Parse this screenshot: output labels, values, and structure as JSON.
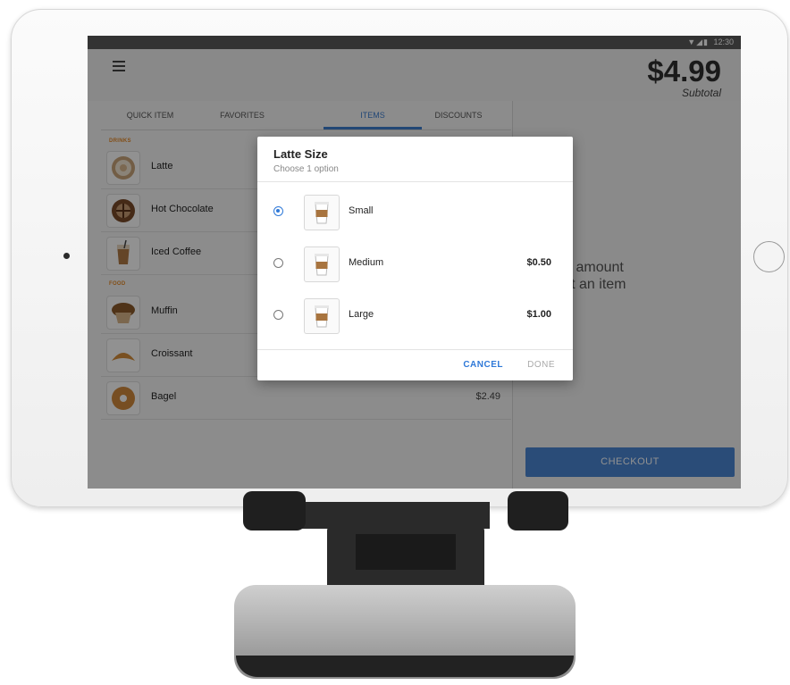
{
  "status_bar": {
    "icons": "▼◢▮",
    "time": "12:30"
  },
  "header": {
    "subtotal_amount": "$4.99",
    "subtotal_label": "Subtotal"
  },
  "tabs": [
    {
      "label": "QUICK ITEM",
      "active": false
    },
    {
      "label": "FAVORITES",
      "active": false
    },
    {
      "label": "ITEMS",
      "active": true
    },
    {
      "label": "DISCOUNTS",
      "active": false
    }
  ],
  "sections": {
    "drinks": "DRINKS",
    "food": "FOOD"
  },
  "items": [
    {
      "name": "Latte",
      "price": ""
    },
    {
      "name": "Hot Chocolate",
      "price": ""
    },
    {
      "name": "Iced Coffee",
      "price": ""
    },
    {
      "name": "Muffin",
      "price": ""
    },
    {
      "name": "Croissant",
      "price": ""
    },
    {
      "name": "Bagel",
      "price": "$2.49"
    }
  ],
  "right_panel": {
    "hint_line1": "ype an amount",
    "hint_line2": "r select an item",
    "checkout_label": "CHECKOUT"
  },
  "dialog": {
    "title": "Latte Size",
    "subtitle": "Choose 1 option",
    "options": [
      {
        "label": "Small",
        "price": "",
        "selected": true
      },
      {
        "label": "Medium",
        "price": "$0.50",
        "selected": false
      },
      {
        "label": "Large",
        "price": "$1.00",
        "selected": false
      }
    ],
    "cancel_label": "CANCEL",
    "done_label": "DONE"
  },
  "colors": {
    "accent": "#2f79d8",
    "section_label": "#e58a2a",
    "checkout": "#4a86d4"
  }
}
